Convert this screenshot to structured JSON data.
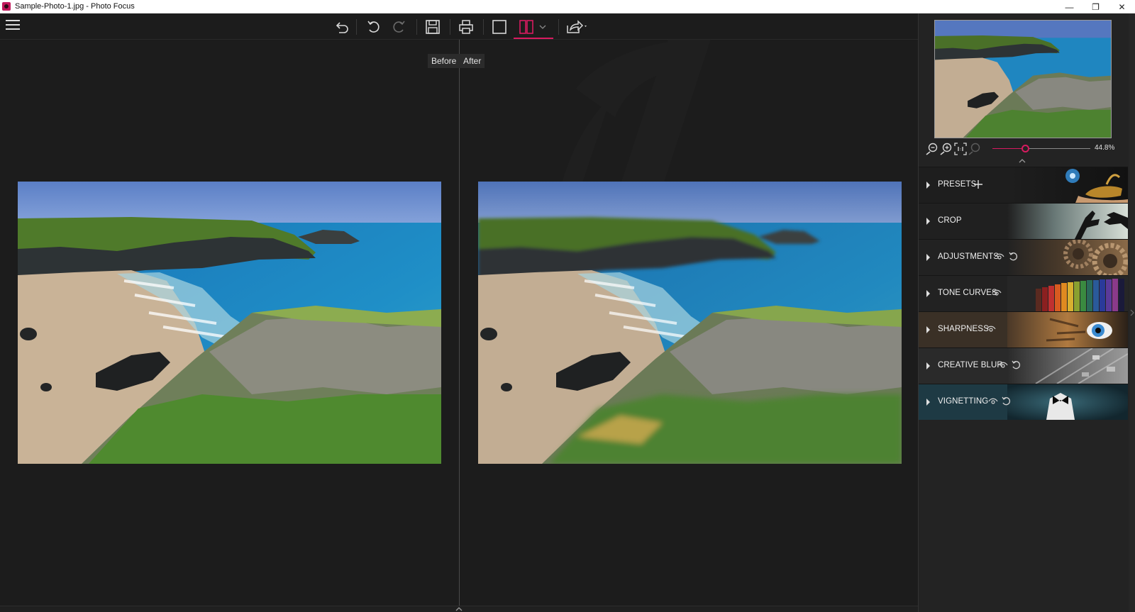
{
  "window": {
    "title": "Sample-Photo-1.jpg - Photo Focus",
    "minimize_glyph": "—",
    "restore_glyph": "❐",
    "close_glyph": "✕"
  },
  "toolbar": {
    "icons": [
      "menu-icon",
      "undo-all-icon",
      "undo-icon",
      "redo-icon",
      "save-icon",
      "print-icon",
      "single-view-icon",
      "split-view-icon",
      "chevron-down-icon",
      "share-icon"
    ],
    "active_view": "split",
    "accent_color": "#d81b60"
  },
  "compare": {
    "before_label": "Before",
    "after_label": "After"
  },
  "navigator": {
    "zoom_value": "44.8%",
    "zoom_level": 0.33
  },
  "sections": [
    {
      "label": "PRESETS",
      "extras": [
        "plus-icon"
      ]
    },
    {
      "label": "CROP",
      "extras": []
    },
    {
      "label": "ADJUSTMENTS",
      "extras": [
        "eye-icon",
        "reset-icon"
      ]
    },
    {
      "label": "TONE CURVES",
      "extras": [
        "eye-icon"
      ]
    },
    {
      "label": "SHARPNESS",
      "extras": [
        "eye-icon"
      ]
    },
    {
      "label": "CREATIVE BLUR",
      "extras": [
        "eye-icon",
        "reset-icon"
      ]
    },
    {
      "label": "VIGNETTING",
      "extras": [
        "eye-icon",
        "reset-icon"
      ]
    }
  ]
}
